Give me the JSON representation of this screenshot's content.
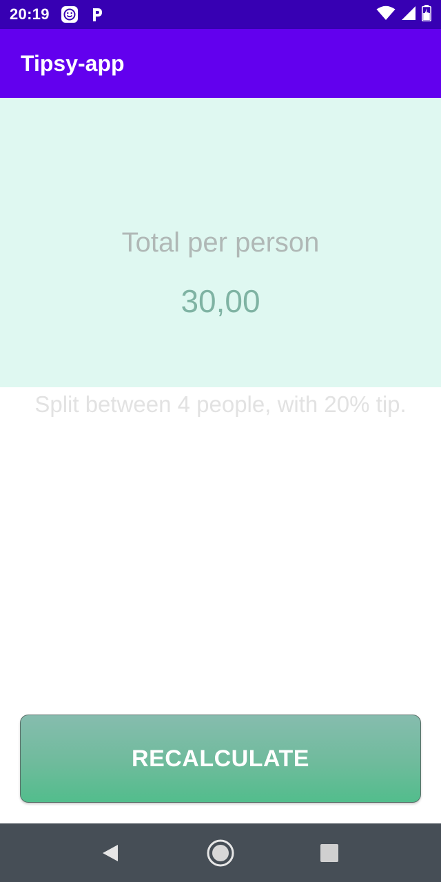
{
  "status_bar": {
    "time": "20:19",
    "notification_icons": [
      "smiley-app-icon",
      "parking-app-icon"
    ],
    "right_icons": [
      "wifi-icon",
      "cellular-signal-icon",
      "battery-charging-icon"
    ]
  },
  "app_bar": {
    "title": "Tipsy-app"
  },
  "result": {
    "label": "Total per person",
    "value": "30,00"
  },
  "split_info": "Split between 4 people, with 20% tip.",
  "actions": {
    "recalculate_label": "RECALCULATE"
  },
  "nav_bar": {
    "icons": [
      "back-icon",
      "home-icon",
      "recents-icon"
    ]
  },
  "colors": {
    "status_bar": "#3700b3",
    "app_bar": "#6200ee",
    "result_panel": "#dff8f1",
    "button_top": "#86bcae",
    "button_bottom": "#52bd8c",
    "nav_bar": "#464e56"
  }
}
